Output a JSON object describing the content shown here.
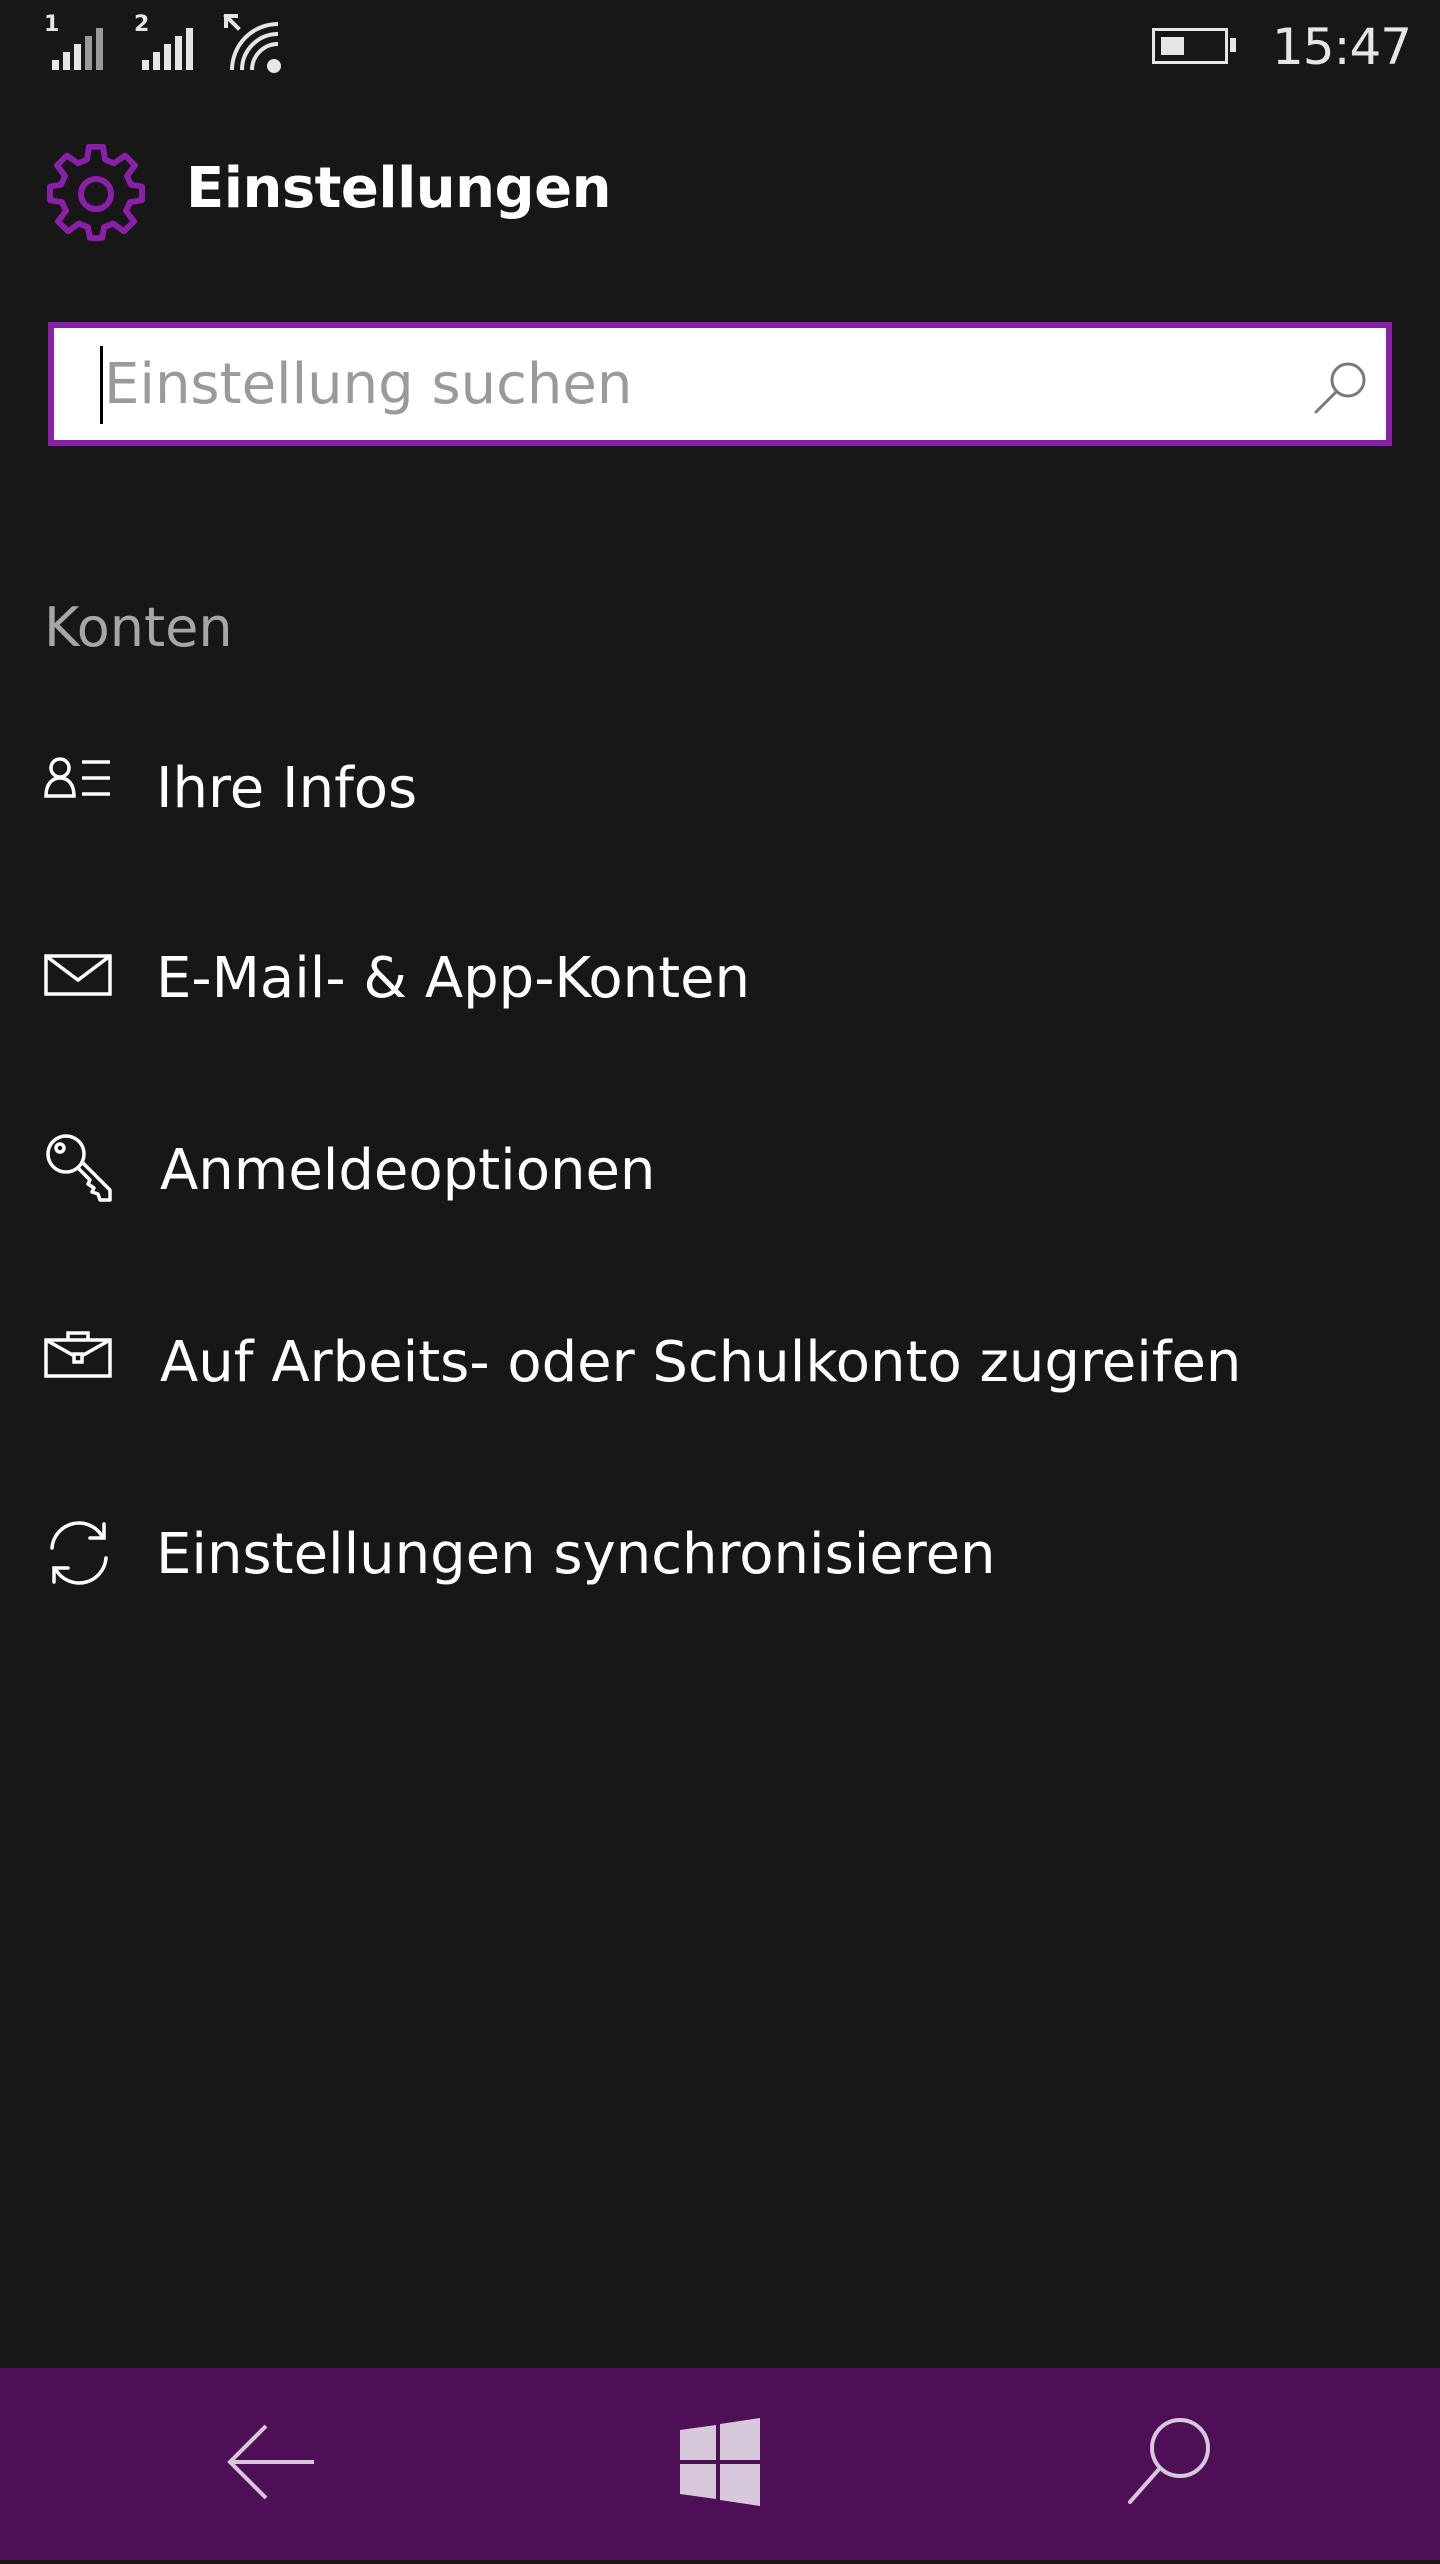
{
  "status_bar": {
    "sim1_label": "1",
    "sim2_label": "2",
    "signal_icon": "cellular-signal-icon",
    "wifi_icon": "wifi-icon",
    "battery_icon": "battery-icon",
    "battery_level_percent": 40,
    "time": "15:47"
  },
  "header": {
    "icon": "gear-icon",
    "title": "Einstellungen"
  },
  "search": {
    "placeholder": "Einstellung suchen",
    "value": "",
    "icon": "search-icon"
  },
  "section": {
    "heading": "Konten",
    "items": [
      {
        "icon": "user-info-icon",
        "label": "Ihre Infos"
      },
      {
        "icon": "mail-icon",
        "label": "E-Mail- & App-Konten"
      },
      {
        "icon": "key-icon",
        "label": "Anmeldeoptionen"
      },
      {
        "icon": "briefcase-icon",
        "label": "Auf Arbeits- oder Schulkonto zugreifen"
      },
      {
        "icon": "sync-icon",
        "label": "Einstellungen synchronisieren"
      }
    ]
  },
  "nav_bar": {
    "back_icon": "back-arrow-icon",
    "start_icon": "windows-logo-icon",
    "search_icon": "search-icon"
  },
  "colors": {
    "background": "#171717",
    "accent": "#8a1fa8",
    "nav_background": "#4f0f57",
    "text": "#ffffff",
    "secondary_text": "#a6a6a6"
  }
}
